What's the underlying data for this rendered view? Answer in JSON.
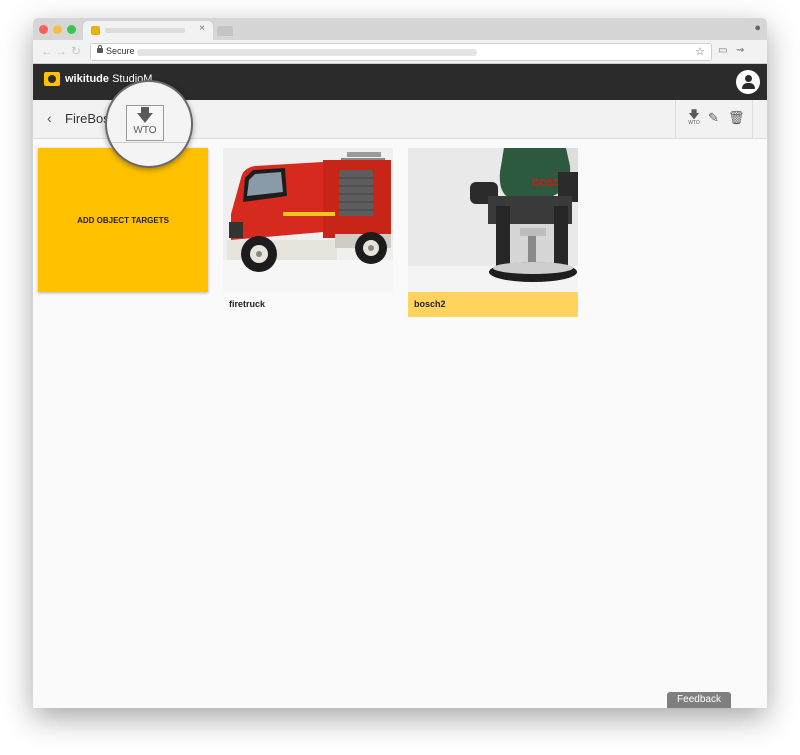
{
  "browser": {
    "tab_close": "×",
    "address_secure": "Secure"
  },
  "app": {
    "brand_bold": "wikitude",
    "brand_rest": " StudioM"
  },
  "project": {
    "back_glyph": "‹",
    "name": "FireBos"
  },
  "toolbar": {
    "download_label": "WTO",
    "magnified_label": "WTO"
  },
  "add_target": {
    "label": "ADD OBJECT TARGETS"
  },
  "targets": [
    {
      "name": "firetruck",
      "selected": false
    },
    {
      "name": "bosch2",
      "selected": true
    }
  ],
  "bosch_text": "BOSCH",
  "feedback": {
    "label": "Feedback"
  },
  "colors": {
    "accent": "#ffc100",
    "selected_label": "#ffd45e",
    "appbar": "#2b2b2b"
  }
}
